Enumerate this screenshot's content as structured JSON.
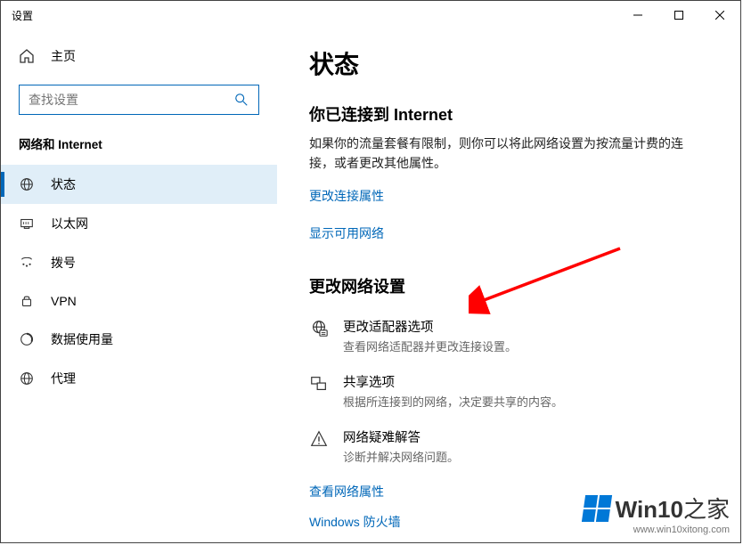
{
  "window": {
    "title": "设置"
  },
  "sidebar": {
    "home": "主页",
    "search_placeholder": "查找设置",
    "section": "网络和 Internet",
    "items": [
      {
        "label": "状态"
      },
      {
        "label": "以太网"
      },
      {
        "label": "拨号"
      },
      {
        "label": "VPN"
      },
      {
        "label": "数据使用量"
      },
      {
        "label": "代理"
      }
    ]
  },
  "main": {
    "heading": "状态",
    "connected_title": "你已连接到 Internet",
    "connected_body": "如果你的流量套餐有限制，则你可以将此网络设置为按流量计费的连接，或者更改其他属性。",
    "link_change_props": "更改连接属性",
    "link_show_networks": "显示可用网络",
    "change_settings_heading": "更改网络设置",
    "options": [
      {
        "title": "更改适配器选项",
        "desc": "查看网络适配器并更改连接设置。"
      },
      {
        "title": "共享选项",
        "desc": "根据所连接到的网络，决定要共享的内容。"
      },
      {
        "title": "网络疑难解答",
        "desc": "诊断并解决网络问题。"
      }
    ],
    "link_view_props": "查看网络属性",
    "link_firewall": "Windows 防火墙"
  },
  "watermark": {
    "brand": "Win10",
    "suffix": "之家",
    "url": "www.win10xitong.com"
  }
}
